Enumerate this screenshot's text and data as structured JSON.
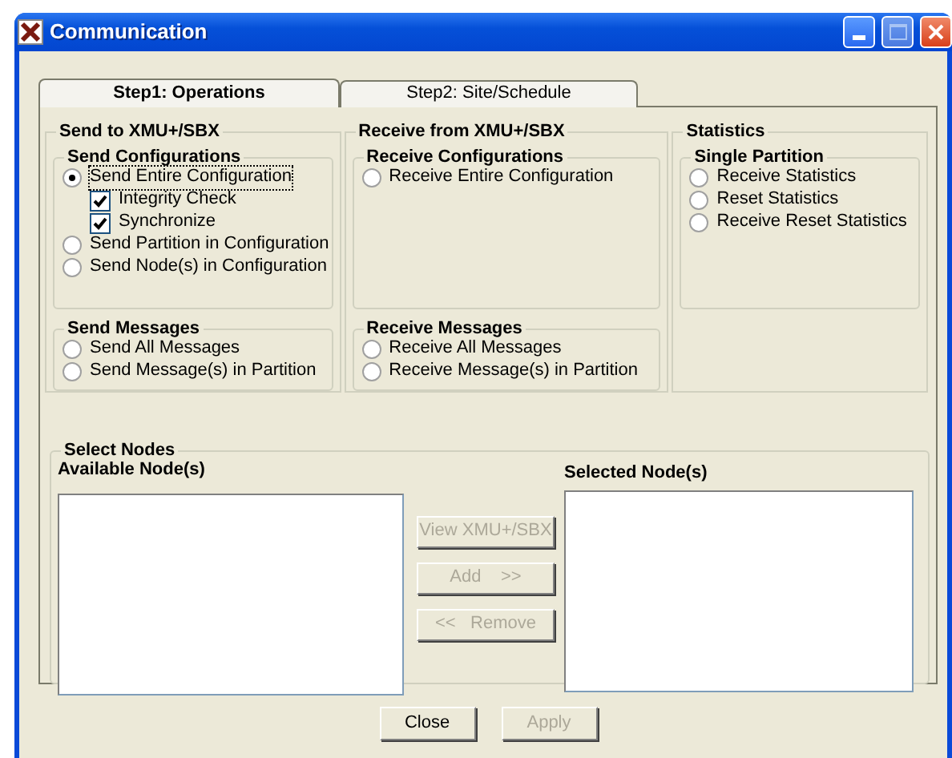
{
  "window": {
    "title": "Communication"
  },
  "tabs": [
    {
      "label": "Step1: Operations",
      "selected": true
    },
    {
      "label": "Step2: Site/Schedule",
      "selected": false
    }
  ],
  "sections": [
    {
      "title": "Send to XMU+/SBX",
      "groups": [
        {
          "title": "Send Configurations",
          "options": [
            {
              "label": "Send Entire Configuration",
              "selected": true,
              "focused": true,
              "children": [
                {
                  "label": "Integrity Check",
                  "checked": true
                },
                {
                  "label": "Synchronize",
                  "checked": true
                }
              ]
            },
            {
              "label": "Send Partition in Configuration",
              "selected": false,
              "focused": false
            },
            {
              "label": "Send Node(s) in Configuration",
              "selected": false,
              "focused": false
            }
          ]
        },
        {
          "title": "Send Messages",
          "options": [
            {
              "label": "Send All Messages",
              "selected": false,
              "focused": false
            },
            {
              "label": "Send Message(s) in Partition",
              "selected": false,
              "focused": false
            }
          ]
        }
      ]
    },
    {
      "title": "Receive from XMU+/SBX",
      "groups": [
        {
          "title": "Receive Configurations",
          "options": [
            {
              "label": "Receive Entire Configuration",
              "selected": false,
              "focused": false
            }
          ]
        },
        {
          "title": "Receive Messages",
          "options": [
            {
              "label": "Receive All Messages",
              "selected": false,
              "focused": false
            },
            {
              "label": "Receive Message(s) in Partition",
              "selected": false,
              "focused": false
            }
          ]
        }
      ]
    },
    {
      "title": "Statistics",
      "groups": [
        {
          "title": "Single Partition",
          "options": [
            {
              "label": "Receive Statistics",
              "selected": false,
              "focused": false
            },
            {
              "label": "Reset Statistics",
              "selected": false,
              "focused": false
            },
            {
              "label": "Receive Reset Statistics",
              "selected": false,
              "focused": false
            }
          ]
        }
      ]
    }
  ],
  "select_nodes": {
    "title": "Select Nodes",
    "available_label": "Available Node(s)",
    "selected_label": "Selected Node(s)",
    "buttons": [
      {
        "label": "View XMU+/SBX",
        "disabled": true
      },
      {
        "label": "Add    >>",
        "disabled": true
      },
      {
        "label": "<<   Remove",
        "disabled": true
      }
    ]
  },
  "footer_buttons": [
    {
      "label": "Close",
      "disabled": false
    },
    {
      "label": "Apply",
      "disabled": true
    }
  ]
}
